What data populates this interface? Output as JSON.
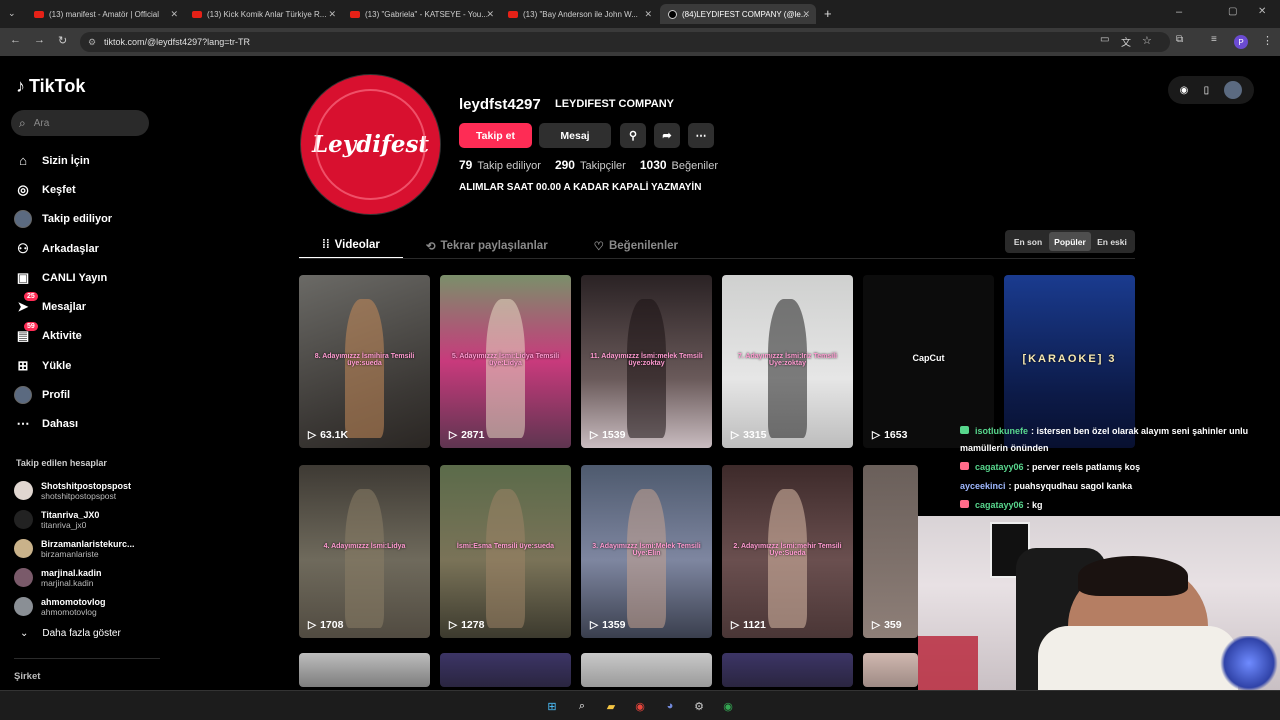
{
  "browser": {
    "tabs": [
      {
        "title": "(13) manifest - Amatör | Official",
        "active": false
      },
      {
        "title": "(13) Kick Komik Anlar Türkiye R...",
        "active": false
      },
      {
        "title": "(13) \"Gabriela\" - KATSEYE - You...",
        "active": false
      },
      {
        "title": "(13) \"Bay Anderson ile John W...",
        "active": false
      },
      {
        "title": "(84)LEYDIFEST COMPANY (@le...",
        "active": true
      }
    ],
    "url": "tiktok.com/@leydfst4297?lang=tr-TR",
    "new_tab": "+"
  },
  "sidebar": {
    "brand": "TikTok",
    "search_placeholder": "Ara",
    "items": [
      {
        "label": "Sizin İçin",
        "icon": "home-icon"
      },
      {
        "label": "Keşfet",
        "icon": "compass-icon"
      },
      {
        "label": "Takip ediliyor",
        "icon": "following-avatar"
      },
      {
        "label": "Arkadaşlar",
        "icon": "friends-icon"
      },
      {
        "label": "CANLI Yayın",
        "icon": "live-icon"
      },
      {
        "label": "Mesajlar",
        "icon": "messages-icon",
        "badge": "25"
      },
      {
        "label": "Aktivite",
        "icon": "activity-icon",
        "badge": "59"
      },
      {
        "label": "Yükle",
        "icon": "upload-icon"
      },
      {
        "label": "Profil",
        "icon": "profile-avatar"
      },
      {
        "label": "Dahası",
        "icon": "more-icon"
      }
    ],
    "following_title": "Takip edilen hesaplar",
    "accounts": [
      {
        "name": "Shotshitpostopspost",
        "handle": "shotshitpostopspost"
      },
      {
        "name": "Titanriva_JX0",
        "handle": "titanriva_jx0"
      },
      {
        "name": "Birzamanlaristekurc...",
        "handle": "birzamanlariste"
      },
      {
        "name": "marjinal.kadin",
        "handle": "marjinal.kadin"
      },
      {
        "name": "ahmomotovlog",
        "handle": "ahmomotovlog"
      }
    ],
    "show_more": "Daha fazla göster",
    "company": "Şirket"
  },
  "profile": {
    "avatar_text": "Leydifest",
    "username": "leydfst4297",
    "nickname": "LEYDIFEST COMPANY",
    "follow_label": "Takip et",
    "message_label": "Mesaj",
    "following_count": "79",
    "following_label": "Takip ediliyor",
    "followers_count": "290",
    "followers_label": "Takipçiler",
    "likes_count": "1030",
    "likes_label": "Beğeniler",
    "bio": "ALIMLAR SAAT 00.00 A KADAR KAPALİ YAZMAYİN"
  },
  "tabs": {
    "videos": "Videolar",
    "reposts": "Tekrar paylaşılanlar",
    "liked": "Beğenilenler"
  },
  "sort": {
    "latest": "En son",
    "popular": "Popüler",
    "oldest": "En eski"
  },
  "videos": [
    {
      "views": "63.1K",
      "caption": "8. Adayımızzz İsmihira Temsili üye:sueda"
    },
    {
      "views": "2871",
      "caption": "5. Adayımızzz İsmi:Lidya Temsili üye:Lidya"
    },
    {
      "views": "1539",
      "caption": "11. Adayımızzz İsmi:melek Temsili üye:zoktay"
    },
    {
      "views": "3315",
      "caption": "7. Adayımızzz İsmi:Iriz Temsili Üye:zoktay"
    },
    {
      "views": "1653",
      "caption": "CapCut"
    },
    {
      "views": "",
      "caption": "[KARAOKE] 3"
    },
    {
      "views": "1708",
      "caption": "4. Adayımızzz İsmi:Lidya"
    },
    {
      "views": "1278",
      "caption": "İsmi:Esma Temsili üye:sueda"
    },
    {
      "views": "1359",
      "caption": "3. Adayımızzz İsmi:Melek Temsili Üye:Elin"
    },
    {
      "views": "1121",
      "caption": "2. Adayımızzz İsmi:mehir Temsili Üye:Sueda"
    },
    {
      "views": "359",
      "caption": ""
    }
  ],
  "chat": [
    {
      "user": "isotlukunefe",
      "text": ": istersen ben özel olarak alayım seni şahinler unlu"
    },
    {
      "user": "",
      "text": "mamüllerin önünden"
    },
    {
      "user": "cagatayy06",
      "text": ": perver reels patlamış koş"
    },
    {
      "user": "ayceekinci",
      "text": ": puahsyqudhau sagol kanka"
    },
    {
      "user": "cagatayy06",
      "text": ": kg"
    }
  ],
  "colors": {
    "accent": "#fe2c55",
    "background": "#000000",
    "chat_username": "#58d68d"
  }
}
